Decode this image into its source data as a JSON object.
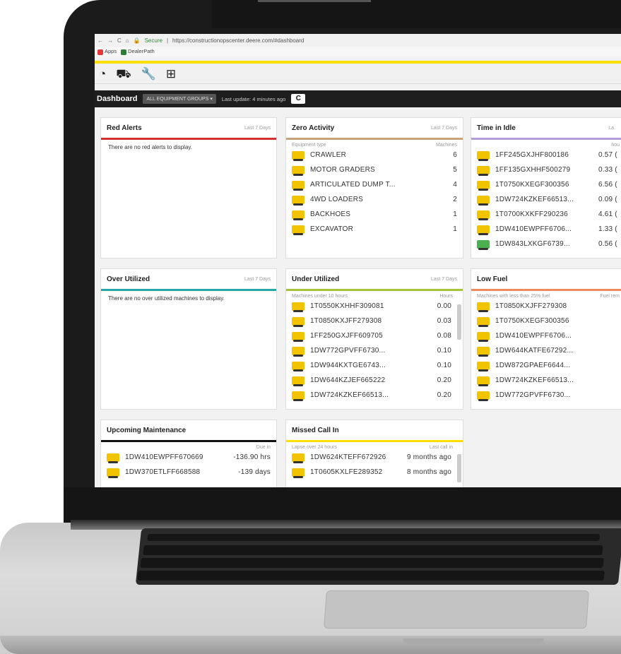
{
  "browser": {
    "secure_label": "Secure",
    "url": "https://constructionopscenter.deere.com/#dashboard",
    "bookmarks": [
      "Apps",
      "DealerPath"
    ]
  },
  "toolbar": {
    "icons": [
      "gauge-icon",
      "map-icon",
      "wrench-icon",
      "grid-icon"
    ]
  },
  "dashboard": {
    "title": "Dashboard",
    "group_select": "ALL EQUIPMENT GROUPS ▾",
    "last_update": "Last update: 4 minutes ago",
    "refresh_glyph": "C"
  },
  "panels": {
    "red_alerts": {
      "title": "Red Alerts",
      "range": "Last 7 Days",
      "message": "There are no red alerts to display.",
      "color": "#d32f2f"
    },
    "zero_activity": {
      "title": "Zero Activity",
      "range": "Last 7 Days",
      "color": "#c9a27a",
      "col1": "Equipment type",
      "col2": "Machines",
      "rows": [
        {
          "name": "CRAWLER",
          "val": "6"
        },
        {
          "name": "MOTOR GRADERS",
          "val": "5"
        },
        {
          "name": "ARTICULATED DUMP T...",
          "val": "4"
        },
        {
          "name": "4WD LOADERS",
          "val": "2"
        },
        {
          "name": "BACKHOES",
          "val": "1"
        },
        {
          "name": "EXCAVATOR",
          "val": "1"
        }
      ]
    },
    "time_in_idle": {
      "title": "Time in Idle",
      "range": "La",
      "color": "#b39ddb",
      "col2": "hou",
      "rows": [
        {
          "name": "1FF245GXJHF800186",
          "val": "0.57 ("
        },
        {
          "name": "1FF135GXHHF500279",
          "val": "0.33 ("
        },
        {
          "name": "1T0750KXEGF300356",
          "val": "6.56 ("
        },
        {
          "name": "1DW724KZKEF66513...",
          "val": "0.09 ("
        },
        {
          "name": "1T0700KXKFF290236",
          "val": "4.61 ("
        },
        {
          "name": "1DW410EWPFF6706...",
          "val": "1.33 ("
        },
        {
          "name": "1DW843LXKGF6739...",
          "val": "0.56 ("
        }
      ]
    },
    "over_utilized": {
      "title": "Over Utilized",
      "range": "Last 7 Days",
      "message": "There are no over utilized machines to display.",
      "color": "#26a6a6"
    },
    "under_utilized": {
      "title": "Under Utilized",
      "range": "Last 7 Days",
      "color": "#a6c43a",
      "col1": "Machines under 10 hours",
      "col2": "Hours",
      "rows": [
        {
          "name": "1T0550KXHHF309081",
          "val": "0.00"
        },
        {
          "name": "1T0850KXJFF279308",
          "val": "0.03"
        },
        {
          "name": "1FF250GXJFF609705",
          "val": "0.08"
        },
        {
          "name": "1DW772GPVFF6730...",
          "val": "0.10"
        },
        {
          "name": "1DW944KXTGE6743...",
          "val": "0.10"
        },
        {
          "name": "1DW644KZJEF665222",
          "val": "0.20"
        },
        {
          "name": "1DW724KZKEF66513...",
          "val": "0.20"
        }
      ]
    },
    "low_fuel": {
      "title": "Low Fuel",
      "color": "#f08a5d",
      "col1": "Machines with less than 25% fuel",
      "col2": "Fuel rem",
      "rows": [
        {
          "name": "1T0850KXJFF279308"
        },
        {
          "name": "1T0750KXEGF300356"
        },
        {
          "name": "1DW410EWPFF6706..."
        },
        {
          "name": "1DW644KATFE67292..."
        },
        {
          "name": "1DW872GPAEF6644..."
        },
        {
          "name": "1DW724KZKEF66513..."
        },
        {
          "name": "1DW772GPVFF6730..."
        }
      ]
    },
    "upcoming_maintenance": {
      "title": "Upcoming Maintenance",
      "color": "#111111",
      "col2": "Due in",
      "rows": [
        {
          "name": "1DW410EWPFF670669",
          "val": "-136.90 hrs"
        },
        {
          "name": "1DW370ETLFF668588",
          "val": "-139 days"
        }
      ]
    },
    "missed_call_in": {
      "title": "Missed Call In",
      "color": "#ffde00",
      "col1": "Lapse over 24 hours",
      "col2": "Last call in",
      "rows": [
        {
          "name": "1DW624KTEFF672926",
          "val": "9 months ago"
        },
        {
          "name": "1T0605KXLFE289352",
          "val": "8 months ago"
        }
      ]
    }
  }
}
